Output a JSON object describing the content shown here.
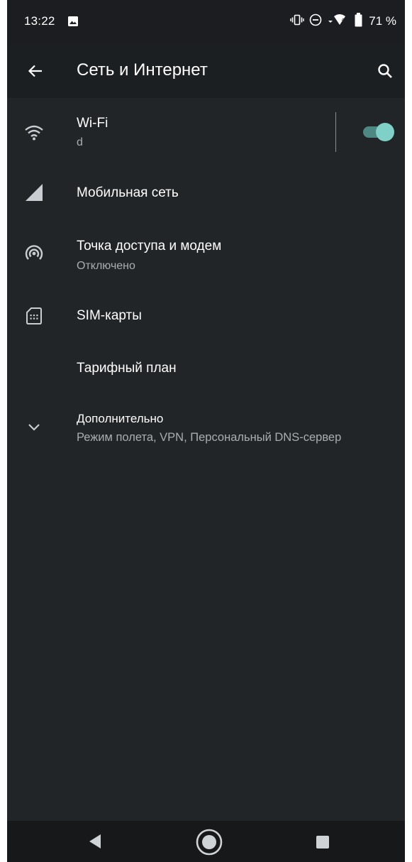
{
  "status_bar": {
    "time": "13:22",
    "battery_percent": "71 %",
    "icons": [
      "image-icon",
      "vibrate-icon",
      "dnd-icon",
      "wifi-signal-icon",
      "battery-icon"
    ]
  },
  "app_bar": {
    "title": "Сеть и Интернет",
    "back_icon": "arrow-left-icon",
    "search_icon": "search-icon"
  },
  "settings": {
    "wifi": {
      "title": "Wi-Fi",
      "subtitle": "d",
      "toggle_on": true,
      "icon": "wifi-icon"
    },
    "mobile": {
      "title": "Мобильная сеть",
      "icon": "cell-signal-icon"
    },
    "hotspot": {
      "title": "Точка доступа и модем",
      "subtitle": "Отключено",
      "icon": "hotspot-icon"
    },
    "sim": {
      "title": "SIM-карты",
      "icon": "sim-card-icon"
    },
    "tariff": {
      "title": "Тарифный план"
    },
    "advanced": {
      "title": "Дополнительно",
      "subtitle": "Режим полета, VPN, Персональный DNS-сервер",
      "icon": "chevron-down-icon"
    }
  },
  "colors": {
    "background": "#222528",
    "app_bar": "#1c1f22",
    "accent_toggle": "#7fd0c6",
    "secondary_text": "#a9adb1"
  },
  "nav_bar": {
    "icons": [
      "nav-back-icon",
      "nav-home-icon",
      "nav-recents-icon"
    ]
  }
}
